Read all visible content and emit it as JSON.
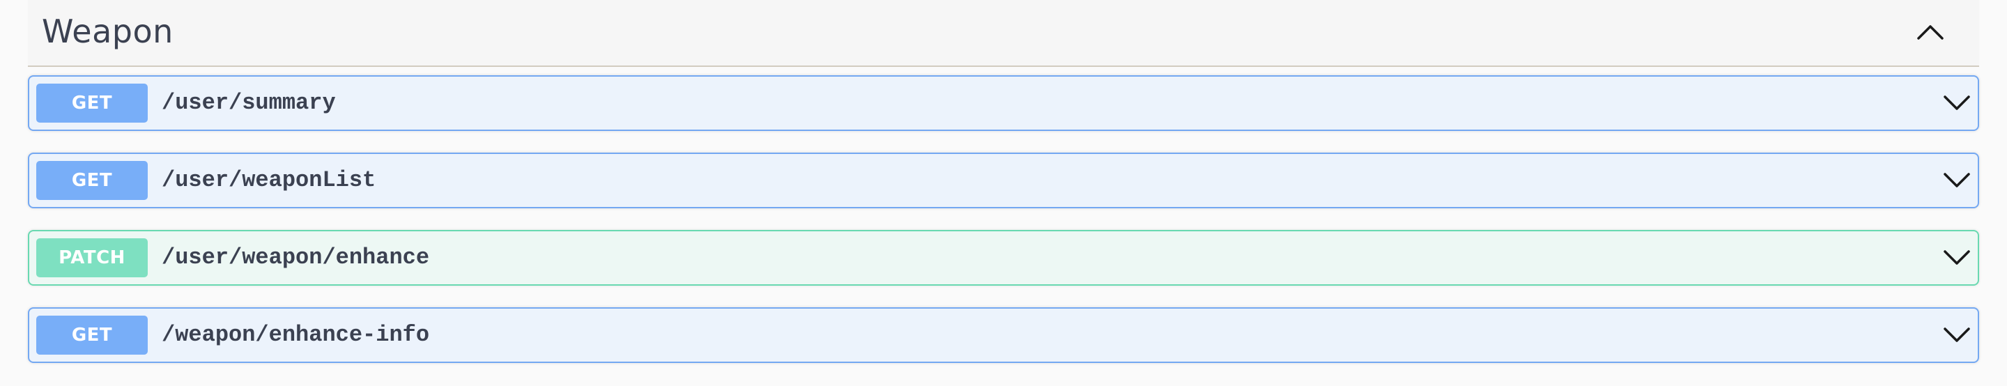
{
  "section": {
    "title": "Weapon",
    "toggle_icon": "chevron-up-icon"
  },
  "operations": [
    {
      "method": "GET",
      "path": "/user/summary",
      "expand_icon": "chevron-down-icon",
      "color": "#78aef8"
    },
    {
      "method": "GET",
      "path": "/user/weaponList",
      "expand_icon": "chevron-down-icon",
      "color": "#78aef8"
    },
    {
      "method": "PATCH",
      "path": "/user/weapon/enhance",
      "expand_icon": "chevron-down-icon",
      "color": "#7ee0c1"
    },
    {
      "method": "GET",
      "path": "/weapon/enhance-info",
      "expand_icon": "chevron-down-icon",
      "color": "#78aef8"
    }
  ],
  "colors": {
    "get_bg": "#ecf3fc",
    "get_border": "#74a8f2",
    "patch_bg": "#edf8f4",
    "patch_border": "#69d9b1",
    "text": "#3b4151"
  }
}
